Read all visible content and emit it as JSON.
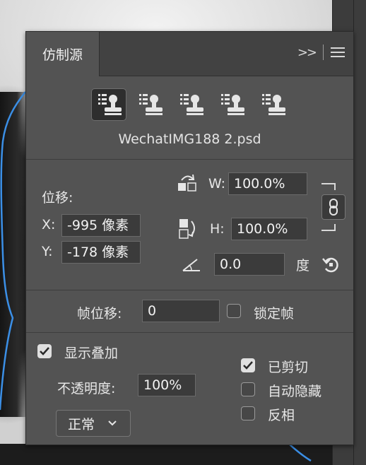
{
  "panel": {
    "tab_title": "仿制源",
    "tab_menu": {
      "collapse_icon": "double-chevron-right-icon",
      "menu_icon": "hamburger-menu-icon"
    },
    "clone_sources": [
      {
        "name": "clone-source-1",
        "icon": "clone-stamp-icon",
        "active": true
      },
      {
        "name": "clone-source-2",
        "icon": "clone-stamp-icon",
        "active": false
      },
      {
        "name": "clone-source-3",
        "icon": "clone-stamp-icon",
        "active": false
      },
      {
        "name": "clone-source-4",
        "icon": "clone-stamp-icon",
        "active": false
      },
      {
        "name": "clone-source-5",
        "icon": "clone-stamp-icon",
        "active": false
      }
    ],
    "file_name": "WechatIMG188 2.psd"
  },
  "offset": {
    "label": "位移:",
    "x_label": "X:",
    "x_value": "-995 像素",
    "y_label": "Y:",
    "y_value": "-178 像素"
  },
  "scale": {
    "w_label": "W:",
    "w_value": "100.0%",
    "h_label": "H:",
    "h_value": "100.0%",
    "angle_value": "0.0",
    "angle_unit": "度",
    "link_icon": "chain-link-icon",
    "reset_icon": "reset-rotate-icon"
  },
  "frame": {
    "label": "帧位移:",
    "value": "0",
    "lock_label": "锁定帧",
    "lock_checked": false
  },
  "overlay": {
    "show_label": "显示叠加",
    "show_checked": true,
    "opacity_label": "不透明度:",
    "opacity_value": "100%",
    "blend_mode": "正常",
    "clipped_label": "已剪切",
    "clipped_checked": true,
    "auto_hide_label": "自动隐藏",
    "auto_hide_checked": false,
    "invert_label": "反相",
    "invert_checked": false
  },
  "colors": {
    "panel_bg": "#535353",
    "field_bg": "#3b3b3b",
    "selection_outline": "#3b8fe6"
  }
}
